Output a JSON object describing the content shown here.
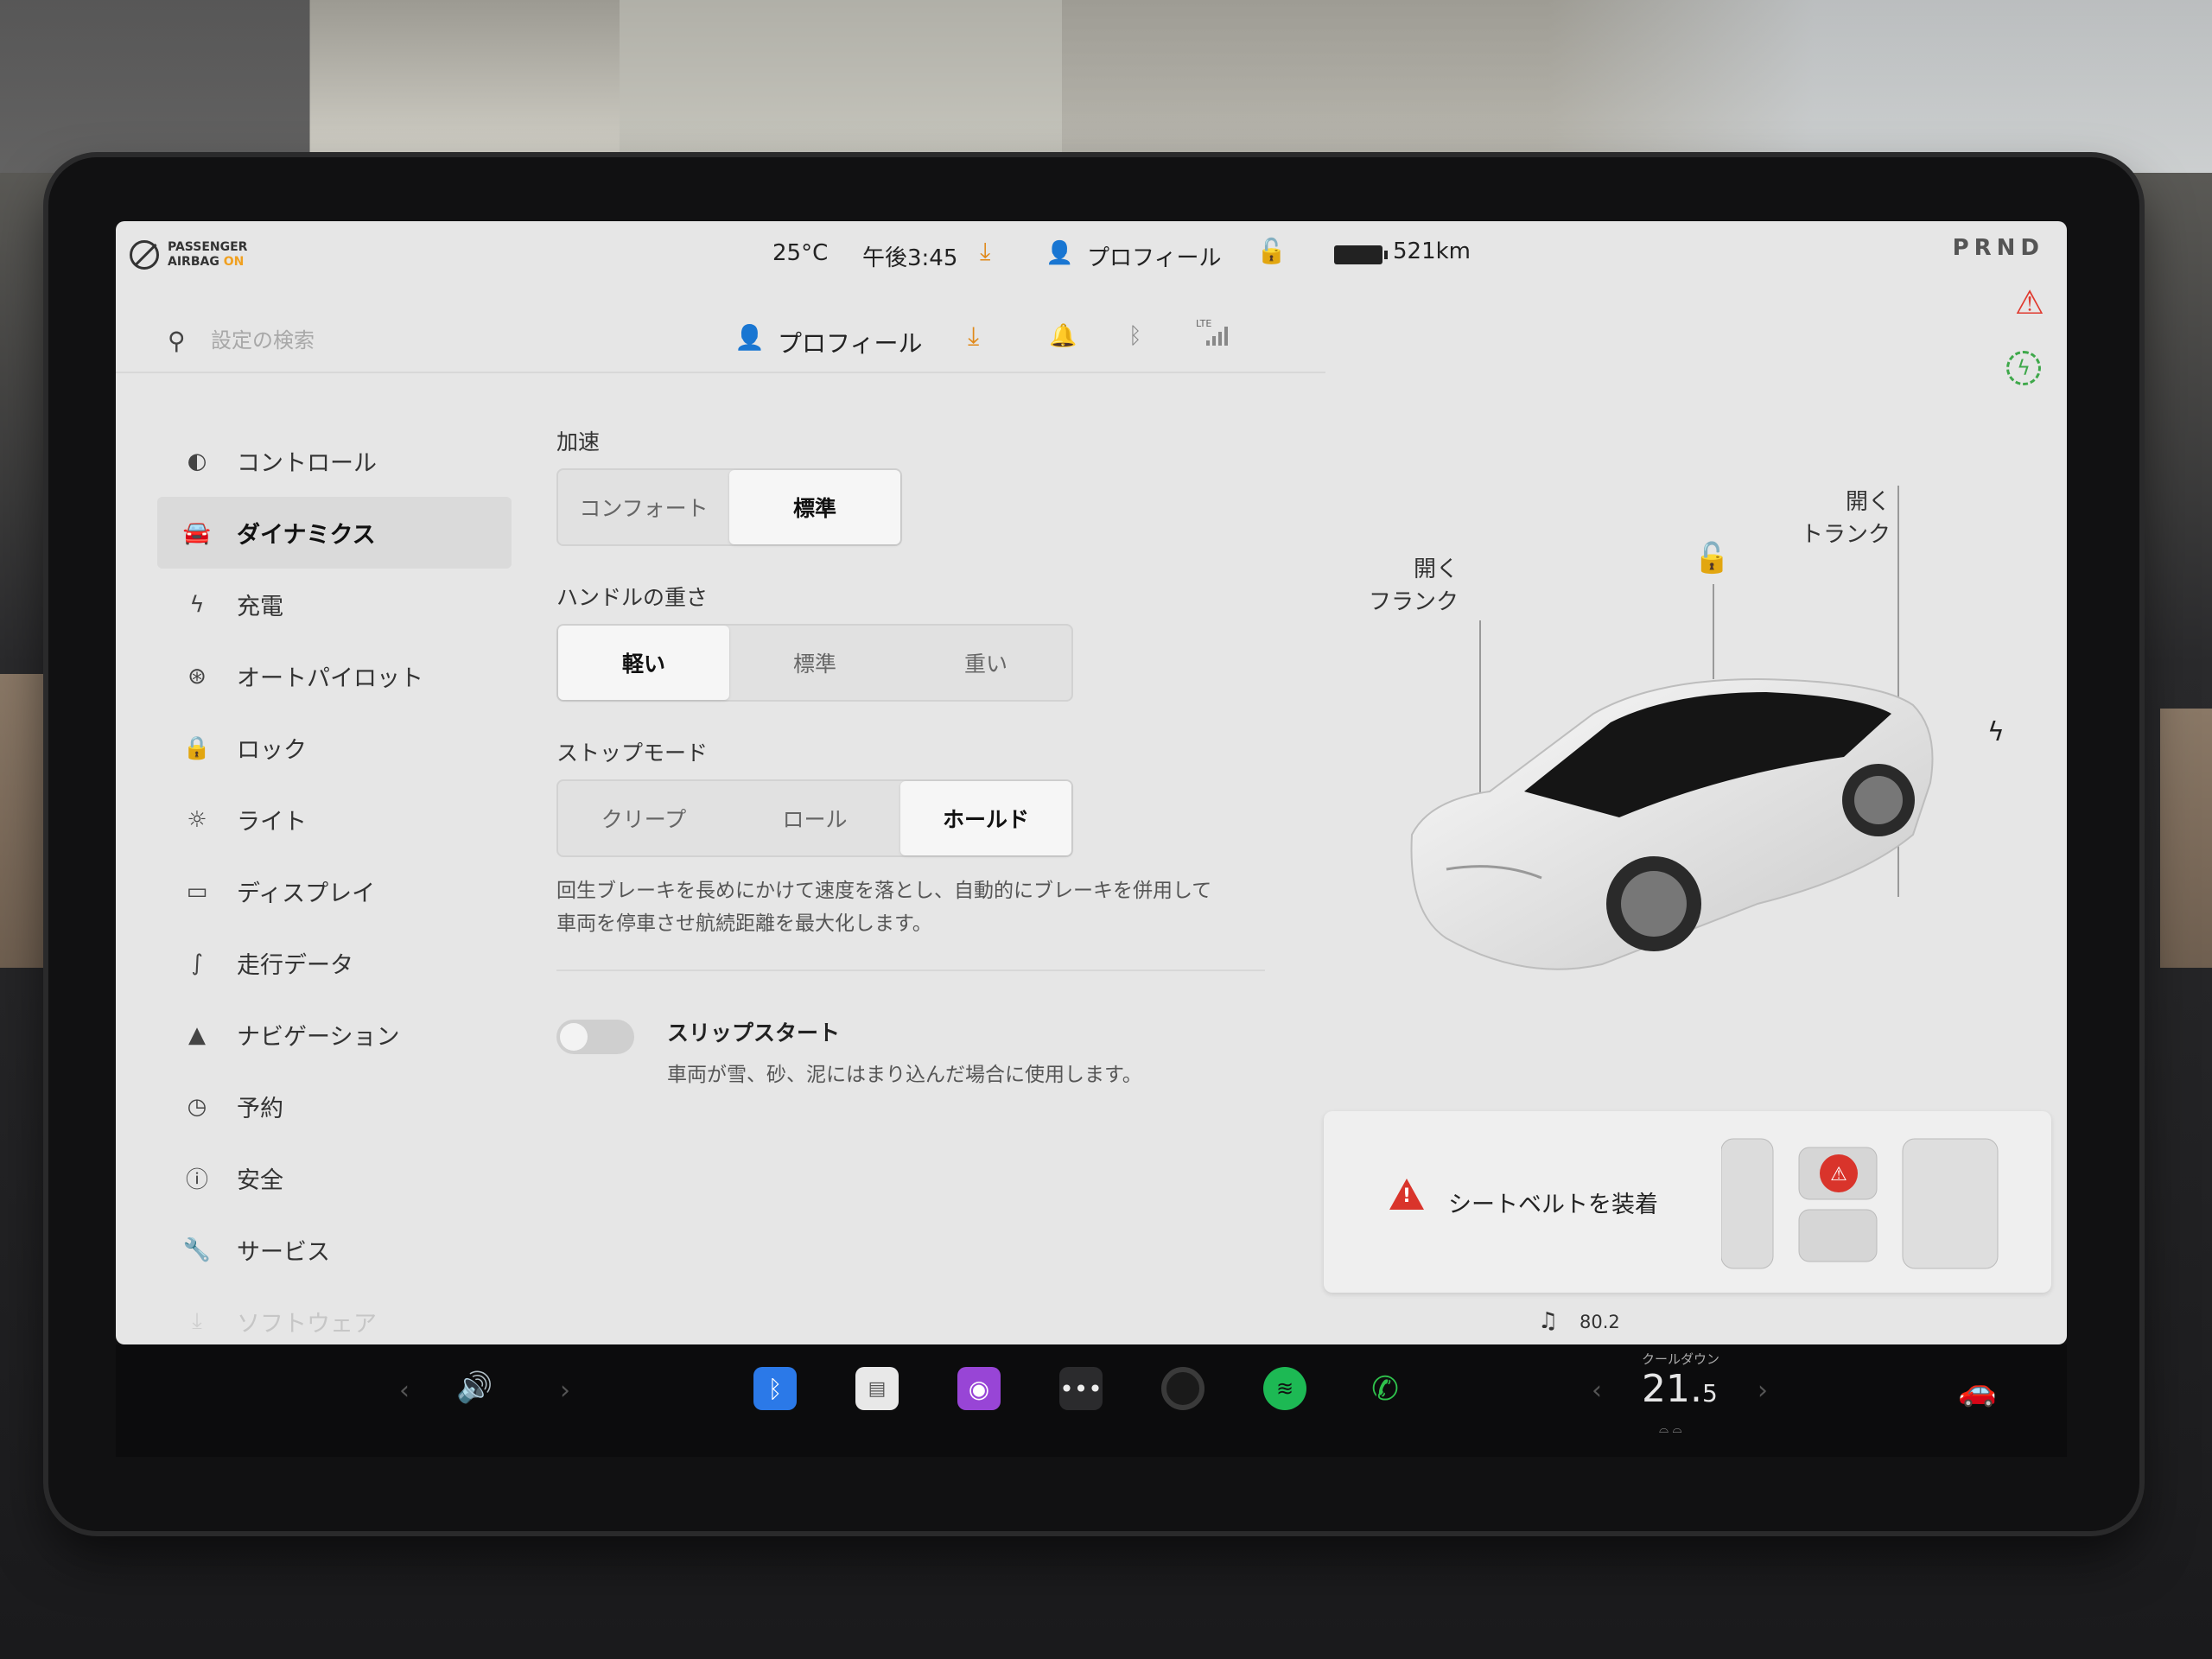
{
  "status_bar": {
    "airbag_line1": "PASSENGER",
    "airbag_line2": "AIRBAG",
    "airbag_state": "ON",
    "temperature": "25°C",
    "time": "午後3:45",
    "profile": "プロフィール",
    "range": "521km",
    "gear": "PRND"
  },
  "top_row": {
    "search_placeholder": "設定の検索",
    "profile": "プロフィール",
    "lte_label": "LTE"
  },
  "menu": {
    "items": [
      {
        "label": "コントロール",
        "icon": "toggle-icon"
      },
      {
        "label": "ダイナミクス",
        "icon": "car-icon"
      },
      {
        "label": "充電",
        "icon": "bolt-icon"
      },
      {
        "label": "オートパイロット",
        "icon": "steering-wheel-icon"
      },
      {
        "label": "ロック",
        "icon": "lock-icon"
      },
      {
        "label": "ライト",
        "icon": "sun-icon"
      },
      {
        "label": "ディスプレイ",
        "icon": "display-icon"
      },
      {
        "label": "走行データ",
        "icon": "trip-icon"
      },
      {
        "label": "ナビゲーション",
        "icon": "navigation-icon"
      },
      {
        "label": "予約",
        "icon": "schedule-icon"
      },
      {
        "label": "安全",
        "icon": "safety-icon"
      },
      {
        "label": "サービス",
        "icon": "wrench-icon"
      },
      {
        "label": "ソフトウェア",
        "icon": "download-icon"
      }
    ],
    "active": "ダイナミクス"
  },
  "dynamics": {
    "acceleration": {
      "label": "加速",
      "options": [
        "コンフォート",
        "標準"
      ],
      "selected": "標準"
    },
    "steering": {
      "label": "ハンドルの重さ",
      "options": [
        "軽い",
        "標準",
        "重い"
      ],
      "selected": "軽い"
    },
    "stop_mode": {
      "label": "ストップモード",
      "options": [
        "クリープ",
        "ロール",
        "ホールド"
      ],
      "selected": "ホールド",
      "description_line1": "回生ブレーキを長めにかけて速度を落とし、自動的にブレーキを併用して",
      "description_line2": "車両を停車させ航続距離を最大化します。"
    },
    "slip_start": {
      "title": "スリップスタート",
      "description": "車両が雪、砂、泥にはまり込んだ場合に使用します。",
      "enabled": false
    }
  },
  "car_panel": {
    "frunk_line1": "開く",
    "frunk_line2": "フランク",
    "trunk_line1": "開く",
    "trunk_line2": "トランク",
    "alert_text": "シートベルトを装着",
    "music_frequency": "80.2"
  },
  "taskbar": {
    "cooldown_label": "クールダウン",
    "temp_whole": "21.",
    "temp_decimal": "5",
    "apps": [
      "bluetooth-icon",
      "notes-icon",
      "podcast-icon",
      "more-icon",
      "camera-icon",
      "spotify-icon",
      "phone-icon"
    ]
  },
  "colors": {
    "accent_orange": "#e0891a",
    "alert_red": "#d9342b",
    "charge_green": "#3ea84a",
    "screen_bg": "#e6e6e6"
  }
}
